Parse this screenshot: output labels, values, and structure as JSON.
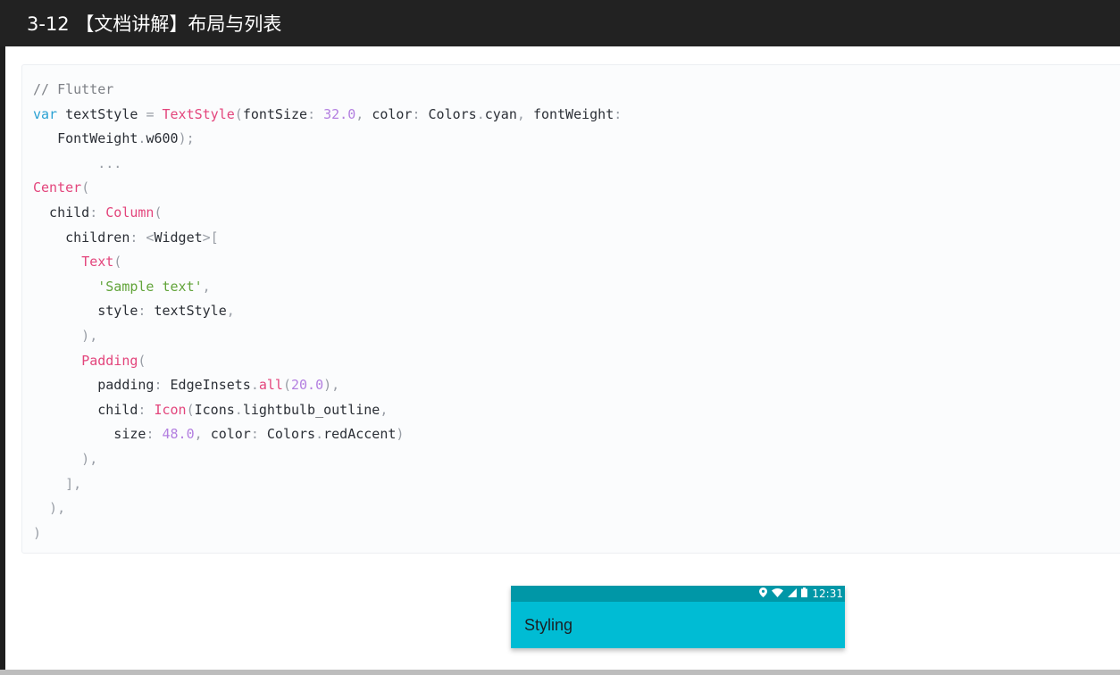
{
  "header": {
    "title": "3-12 【文档讲解】布局与列表"
  },
  "code": {
    "lines": [
      [
        {
          "t": "// Flutter",
          "c": "comment"
        }
      ],
      [
        {
          "t": "var",
          "c": "keyword"
        },
        {
          "t": " textStyle ",
          "c": "plain"
        },
        {
          "t": "=",
          "c": "punct"
        },
        {
          "t": " ",
          "c": "plain"
        },
        {
          "t": "TextStyle",
          "c": "class"
        },
        {
          "t": "(",
          "c": "punct"
        },
        {
          "t": "fontSize",
          "c": "plain"
        },
        {
          "t": ": ",
          "c": "punct"
        },
        {
          "t": "32.0",
          "c": "number"
        },
        {
          "t": ", ",
          "c": "punct"
        },
        {
          "t": "color",
          "c": "plain"
        },
        {
          "t": ": ",
          "c": "punct"
        },
        {
          "t": "Colors",
          "c": "plain"
        },
        {
          "t": ".",
          "c": "punct"
        },
        {
          "t": "cyan",
          "c": "plain"
        },
        {
          "t": ", ",
          "c": "punct"
        },
        {
          "t": "fontWeight",
          "c": "plain"
        },
        {
          "t": ":",
          "c": "punct"
        }
      ],
      [
        {
          "t": "   FontWeight",
          "c": "plain"
        },
        {
          "t": ".",
          "c": "punct"
        },
        {
          "t": "w600",
          "c": "plain"
        },
        {
          "t": ");",
          "c": "punct"
        }
      ],
      [
        {
          "t": "        ...",
          "c": "punct"
        }
      ],
      [
        {
          "t": "Center",
          "c": "class"
        },
        {
          "t": "(",
          "c": "punct"
        }
      ],
      [
        {
          "t": "  child",
          "c": "plain"
        },
        {
          "t": ": ",
          "c": "punct"
        },
        {
          "t": "Column",
          "c": "class"
        },
        {
          "t": "(",
          "c": "punct"
        }
      ],
      [
        {
          "t": "    children",
          "c": "plain"
        },
        {
          "t": ": <",
          "c": "punct"
        },
        {
          "t": "Widget",
          "c": "plain"
        },
        {
          "t": ">[",
          "c": "punct"
        }
      ],
      [
        {
          "t": "      ",
          "c": "plain"
        },
        {
          "t": "Text",
          "c": "class"
        },
        {
          "t": "(",
          "c": "punct"
        }
      ],
      [
        {
          "t": "        ",
          "c": "plain"
        },
        {
          "t": "'Sample text'",
          "c": "string"
        },
        {
          "t": ",",
          "c": "punct"
        }
      ],
      [
        {
          "t": "        style",
          "c": "plain"
        },
        {
          "t": ": ",
          "c": "punct"
        },
        {
          "t": "textStyle",
          "c": "plain"
        },
        {
          "t": ",",
          "c": "punct"
        }
      ],
      [
        {
          "t": "      ),",
          "c": "punct"
        }
      ],
      [
        {
          "t": "      ",
          "c": "plain"
        },
        {
          "t": "Padding",
          "c": "class"
        },
        {
          "t": "(",
          "c": "punct"
        }
      ],
      [
        {
          "t": "        padding",
          "c": "plain"
        },
        {
          "t": ": ",
          "c": "punct"
        },
        {
          "t": "EdgeInsets",
          "c": "plain"
        },
        {
          "t": ".",
          "c": "punct"
        },
        {
          "t": "all",
          "c": "class"
        },
        {
          "t": "(",
          "c": "punct"
        },
        {
          "t": "20.0",
          "c": "number"
        },
        {
          "t": "),",
          "c": "punct"
        }
      ],
      [
        {
          "t": "        child",
          "c": "plain"
        },
        {
          "t": ": ",
          "c": "punct"
        },
        {
          "t": "Icon",
          "c": "class"
        },
        {
          "t": "(",
          "c": "punct"
        },
        {
          "t": "Icons",
          "c": "plain"
        },
        {
          "t": ".",
          "c": "punct"
        },
        {
          "t": "lightbulb_outline",
          "c": "plain"
        },
        {
          "t": ",",
          "c": "punct"
        }
      ],
      [
        {
          "t": "          size",
          "c": "plain"
        },
        {
          "t": ": ",
          "c": "punct"
        },
        {
          "t": "48.0",
          "c": "number"
        },
        {
          "t": ", ",
          "c": "punct"
        },
        {
          "t": "color",
          "c": "plain"
        },
        {
          "t": ": ",
          "c": "punct"
        },
        {
          "t": "Colors",
          "c": "plain"
        },
        {
          "t": ".",
          "c": "punct"
        },
        {
          "t": "redAccent",
          "c": "plain"
        },
        {
          "t": ")",
          "c": "punct"
        }
      ],
      [
        {
          "t": "      ),",
          "c": "punct"
        }
      ],
      [
        {
          "t": "    ],",
          "c": "punct"
        }
      ],
      [
        {
          "t": "  ),",
          "c": "punct"
        }
      ],
      [
        {
          "t": ")",
          "c": "punct"
        }
      ]
    ]
  },
  "phone": {
    "status_time": "12:31",
    "status_icons": [
      "location-icon",
      "wifi-icon",
      "signal-icon",
      "battery-icon"
    ],
    "app_title": "Styling"
  },
  "colors": {
    "topbar": "#222222",
    "status_bar": "#0097a7",
    "app_bar": "#00bcd4"
  }
}
